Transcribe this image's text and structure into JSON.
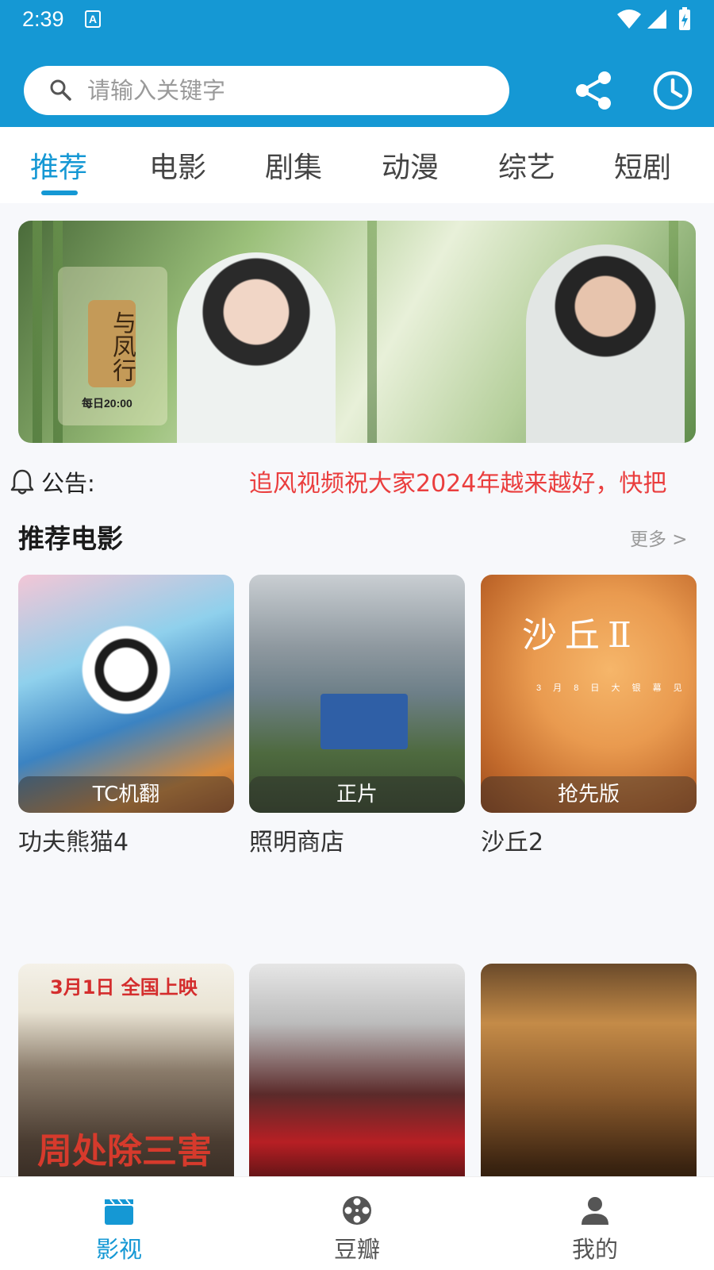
{
  "status_bar": {
    "time": "2:39",
    "app_icon_letter": "A"
  },
  "search": {
    "placeholder": "请输入关键字"
  },
  "header_actions": {
    "share_icon": "share-icon",
    "history_icon": "clock-icon"
  },
  "tabs": [
    {
      "label": "推荐"
    },
    {
      "label": "电影"
    },
    {
      "label": "剧集"
    },
    {
      "label": "动漫"
    },
    {
      "label": "综艺"
    },
    {
      "label": "短剧"
    }
  ],
  "banner": {
    "title": "与凤行",
    "airtime": "每日20:00"
  },
  "notice": {
    "label": "公告:",
    "text": "追风视频祝大家2024年越来越好，快把"
  },
  "section": {
    "title": "推荐电影",
    "more": "更多 >"
  },
  "movies": [
    {
      "title": "功夫熊猫4",
      "badge": "TC机翻"
    },
    {
      "title": "照明商店",
      "badge": "正片"
    },
    {
      "title": "沙丘2",
      "badge": "抢先版",
      "poster_title": "沙丘Ⅱ",
      "poster_date": "3 月 8 日   大 银 幕 见"
    },
    {
      "title": "",
      "badge": "",
      "poster_top": "3月1日 全国上映",
      "poster_big": "周处除三害"
    },
    {
      "title": "",
      "badge": ""
    },
    {
      "title": "",
      "badge": ""
    }
  ],
  "bottom_nav": [
    {
      "label": "影视",
      "icon": "clapperboard-icon"
    },
    {
      "label": "豆瓣",
      "icon": "film-reel-icon"
    },
    {
      "label": "我的",
      "icon": "user-icon"
    }
  ],
  "colors": {
    "brand": "#1598d4",
    "notice_red": "#ea3e3e"
  }
}
